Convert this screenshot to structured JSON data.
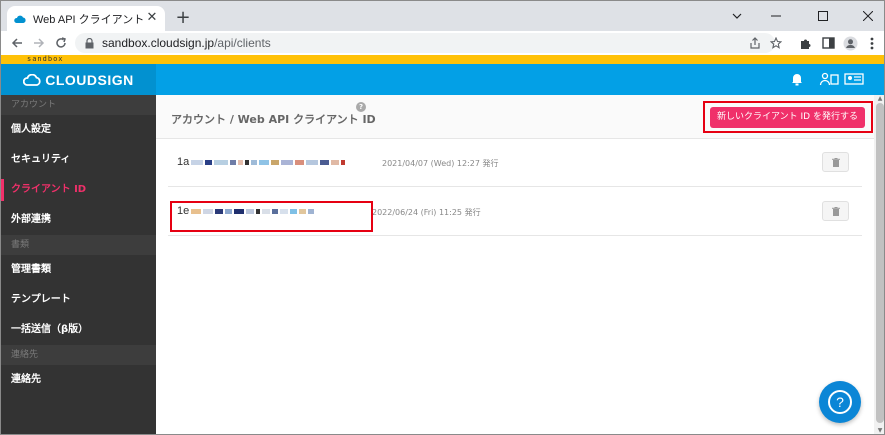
{
  "browser": {
    "tab_title": "Web API クライアント ID - CloudSign",
    "tab_close": "✕",
    "new_tab": "+",
    "url_host": "sandbox.cloudsign.jp",
    "url_path": "/api/clients",
    "window_controls": [
      "minimize",
      "maximize",
      "close"
    ]
  },
  "sandbox_label": "sandbox",
  "app": {
    "logo_text": "CLOUDSIGN",
    "accent_color": "#f0306a",
    "header_color": "#03a0e6"
  },
  "sidebar": {
    "sections": [
      {
        "label": "アカウント",
        "items": [
          {
            "label": "個人設定",
            "active": false
          },
          {
            "label": "セキュリティ",
            "active": false
          },
          {
            "label": "クライアント ID",
            "active": true
          },
          {
            "label": "外部連携",
            "active": false
          }
        ]
      },
      {
        "label": "書類",
        "items": [
          {
            "label": "管理書類",
            "active": false
          },
          {
            "label": "テンプレート",
            "active": false
          },
          {
            "label": "一括送信（β版）",
            "active": false
          }
        ]
      },
      {
        "label": "連絡先",
        "items": [
          {
            "label": "連絡先",
            "active": false
          }
        ]
      }
    ]
  },
  "main": {
    "title": "アカウント / Web API クライアント ID",
    "help_badge": "?",
    "new_button_label": "新しいクライアント ID を発行する",
    "clients": [
      {
        "id_prefix": "1a",
        "issued": "2021/04/07 (Wed) 12:27 発行"
      },
      {
        "id_prefix": "1e",
        "issued": "2022/06/24 (Fri) 11:25 発行"
      }
    ]
  },
  "help_fab": "?"
}
